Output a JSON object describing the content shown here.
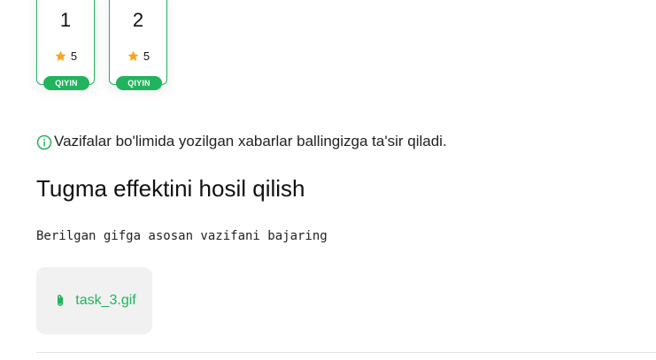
{
  "colors": {
    "accent": "#22b35e",
    "star": "#f5a623",
    "attachment_bg": "#f1f1f1",
    "text": "#222222"
  },
  "task_cards": [
    {
      "number": "1",
      "points": "5",
      "badge": "QIYIN",
      "icon": "star-icon"
    },
    {
      "number": "2",
      "points": "5",
      "badge": "QIYIN",
      "icon": "star-icon"
    }
  ],
  "notice": {
    "icon": "info-icon",
    "text": "Vazifalar bo'limida yozilgan xabarlar ballingizga ta'sir qiladi."
  },
  "task": {
    "title": "Tugma effektini hosil qilish",
    "description": "Berilgan gifga asosan vazifani bajaring",
    "attachment": {
      "icon": "paperclip-icon",
      "file_name": "task_3.gif"
    }
  }
}
